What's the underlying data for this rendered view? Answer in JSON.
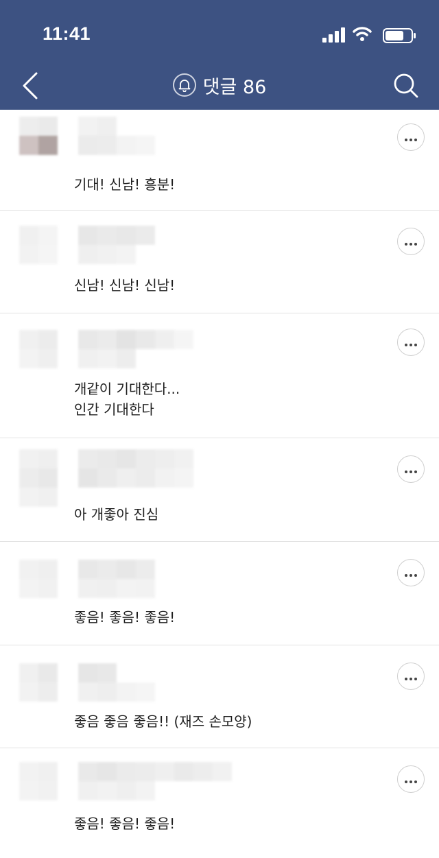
{
  "status": {
    "time": "11:41"
  },
  "header": {
    "title": "댓글 86"
  },
  "icons": {
    "back": "chevron-left-icon",
    "bell": "bell-icon",
    "search": "search-icon",
    "more": "more-horizontal-icon"
  },
  "colors": {
    "header_bg": "#3d5282",
    "divider": "#e2e2e2"
  },
  "comments": [
    {
      "text": "기대! 신남! 흥분!"
    },
    {
      "text": "신남! 신남! 신남!"
    },
    {
      "text": "개같이 기대한다...\n인간 기대한다"
    },
    {
      "text": "아 개좋아 진심"
    },
    {
      "text": "좋음! 좋음! 좋음!"
    },
    {
      "text": "좋음 좋음 좋음!! (재즈 손모양)"
    },
    {
      "text": "좋음! 좋음! 좋음!"
    }
  ]
}
